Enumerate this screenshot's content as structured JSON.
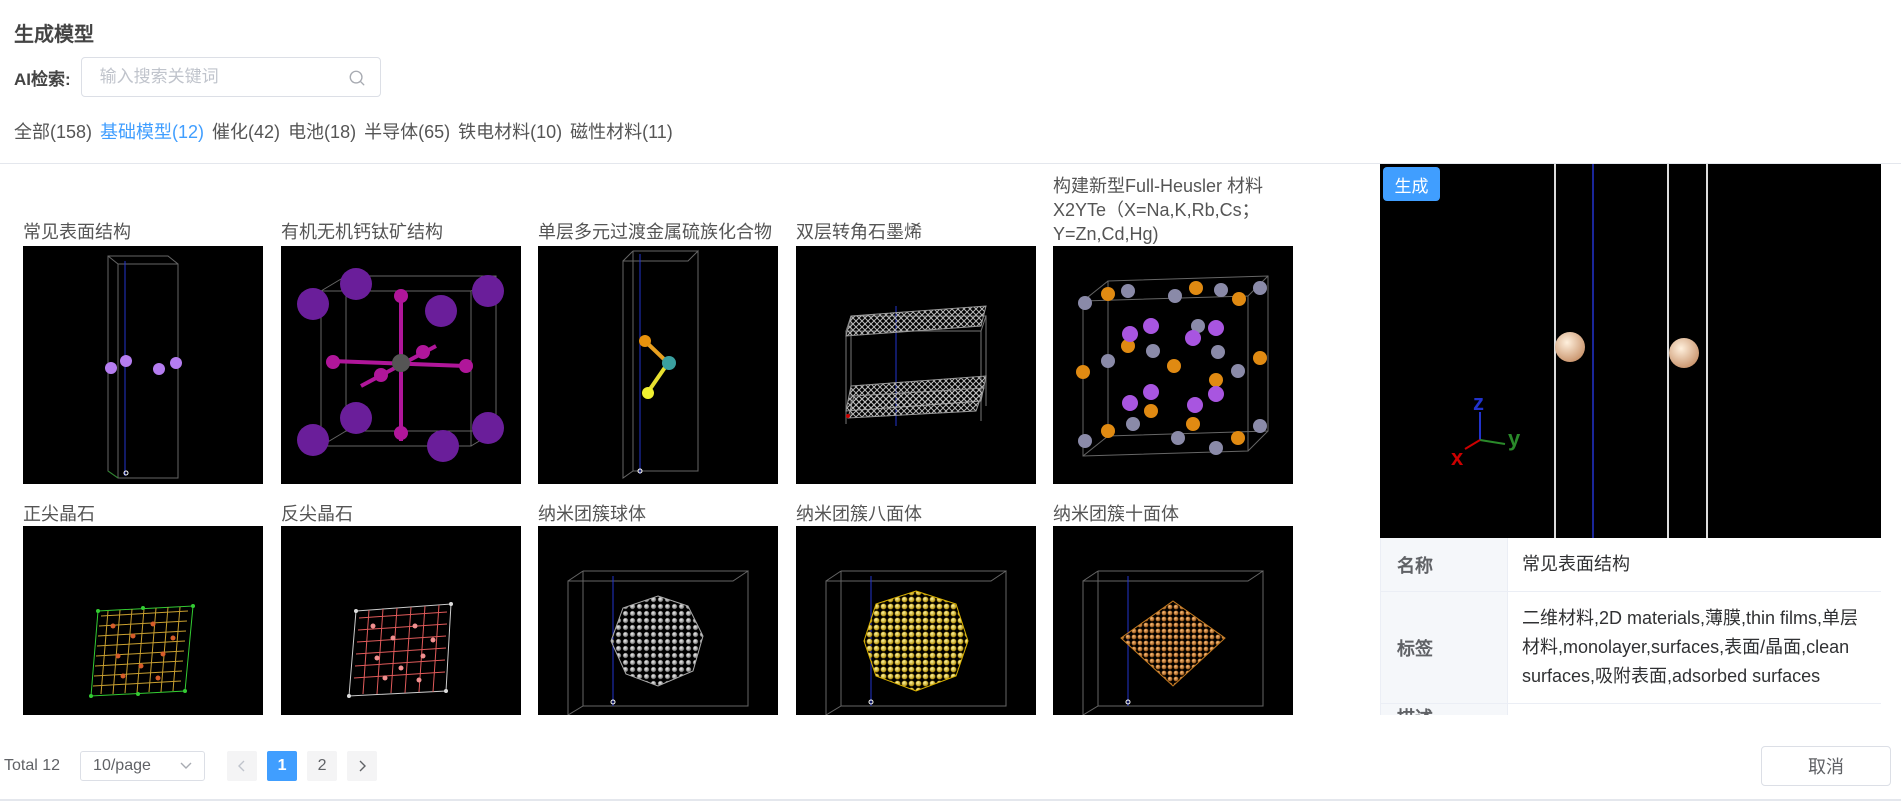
{
  "header": {
    "title": "生成模型"
  },
  "search": {
    "label": "AI检索:",
    "placeholder": "输入搜索关键词",
    "value": ""
  },
  "categories": [
    {
      "label": "全部(158)",
      "active": false
    },
    {
      "label": "基础模型(12)",
      "active": true
    },
    {
      "label": "催化(42)",
      "active": false
    },
    {
      "label": "电池(18)",
      "active": false
    },
    {
      "label": "半导体(65)",
      "active": false
    },
    {
      "label": "铁电材料(10)",
      "active": false
    },
    {
      "label": "磁性材料(11)",
      "active": false
    }
  ],
  "models": [
    {
      "title": "常见表面结构",
      "image": "surface-slab"
    },
    {
      "title": "有机无机钙钛矿结构",
      "image": "perovskite"
    },
    {
      "title": "单层多元过渡金属硫族化合物",
      "image": "tmd-monolayer"
    },
    {
      "title": "双层转角石墨烯",
      "image": "twisted-bilayer-graphene"
    },
    {
      "title": "构建新型Full-Heusler 材料X2YTe（X=Na,K,Rb,Cs；Y=Zn,Cd,Hg)",
      "image": "full-heusler"
    },
    {
      "title": "正尖晶石",
      "image": "normal-spinel"
    },
    {
      "title": "反尖晶石",
      "image": "inverse-spinel"
    },
    {
      "title": "纳米团簇球体",
      "image": "nanocluster-sphere"
    },
    {
      "title": "纳米团簇八面体",
      "image": "nanocluster-octahedron"
    },
    {
      "title": "纳米团簇十面体",
      "image": "nanocluster-decahedron"
    }
  ],
  "viewer": {
    "generate_label": "生成",
    "axes": {
      "x": "x",
      "y": "y",
      "z": "z"
    }
  },
  "info": [
    {
      "key": "名称",
      "value": "常见表面结构"
    },
    {
      "key": "标签",
      "value": "二维材料,2D materials,薄膜,thin films,单层材料,monolayer,surfaces,表面/晶面,clean surfaces,吸附表面,adsorbed surfaces"
    },
    {
      "key": "描述",
      "value": ""
    }
  ],
  "pagination": {
    "total": "Total 12",
    "page_size": "10/page",
    "pages": [
      "1",
      "2"
    ],
    "current": "1"
  },
  "footer": {
    "cancel_label": "取消"
  },
  "colors": {
    "accent": "#409eff"
  }
}
